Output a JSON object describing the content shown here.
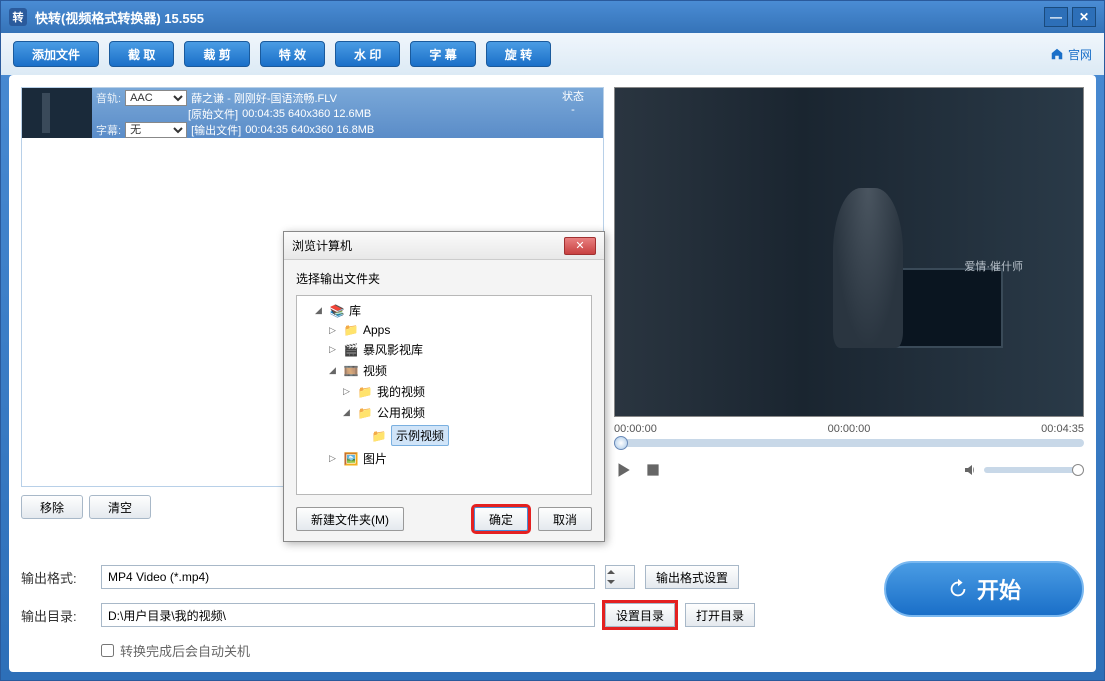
{
  "app": {
    "icon_text": "转",
    "title": "快转(视频格式转换器) 15.555"
  },
  "toolbar": {
    "buttons": [
      "添加文件",
      "截 取",
      "裁 剪",
      "特 效",
      "水 印",
      "字 幕",
      "旋 转"
    ],
    "official_site": "官网"
  },
  "file_list": {
    "audio_label": "音轨:",
    "audio_value": "AAC",
    "subtitle_label": "字幕:",
    "subtitle_value": "无",
    "filename": "薛之谦 - 刚刚好-国语流畅.FLV",
    "original_label": "[原始文件]",
    "output_label": "[输出文件]",
    "original_info": "00:04:35  640x360  12.6MB",
    "output_info": "00:04:35  640x360  16.8MB",
    "status_header": "状态",
    "status_value": "-"
  },
  "list_actions": {
    "remove": "移除",
    "clear": "清空"
  },
  "preview": {
    "watermark": "爱情·催什师",
    "time_start": "00:00:00",
    "time_mid": "00:00:00",
    "time_end": "00:04:35"
  },
  "output": {
    "format_label": "输出格式:",
    "format_value": "MP4 Video (*.mp4)",
    "format_settings": "输出格式设置",
    "dir_label": "输出目录:",
    "dir_value": "D:\\用户目录\\我的视频\\",
    "set_dir": "设置目录",
    "open_dir": "打开目录",
    "auto_shutdown": "转换完成后会自动关机",
    "start": "开始"
  },
  "dialog": {
    "title": "浏览计算机",
    "subtitle": "选择输出文件夹",
    "tree": {
      "library": "库",
      "apps": "Apps",
      "baofeng": "暴风影视库",
      "video": "视频",
      "my_video": "我的视频",
      "public_video": "公用视频",
      "sample_video": "示例视频",
      "pictures": "图片"
    },
    "new_folder": "新建文件夹(M)",
    "ok": "确定",
    "cancel": "取消"
  }
}
